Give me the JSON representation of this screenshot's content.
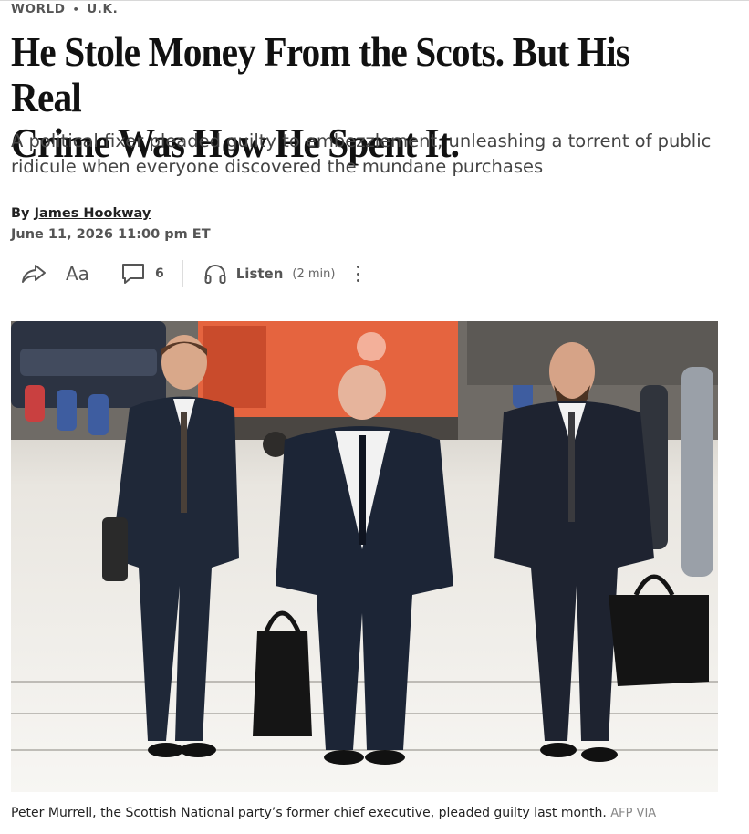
{
  "breadcrumb": {
    "section": "WORLD",
    "subsection": "U.K."
  },
  "article": {
    "headline_line1": "He Stole Money From the Scots. But His Real",
    "headline_line2": "Crime Was How He Spent It.",
    "dek_line1": "A political fixer pleaded guilty to embezzlement, unleashing a torrent of public",
    "dek_line2": "ridicule when everyone discovered the mundane purchases",
    "byline_prefix": "By",
    "author": "James Hookway",
    "date": "June 11, 2026 11:00 pm ET"
  },
  "toolbar": {
    "share_icon": "share-arrow-icon",
    "text_size_label": "Aa",
    "comment_icon": "comment-bubble-icon",
    "comment_count": "6",
    "listen_icon": "headphones-icon",
    "listen_label": "Listen",
    "listen_duration": "(2 min)",
    "more_icon": "vertical-ellipsis-icon"
  },
  "photo": {
    "caption": "Peter Murrell, the Scottish National party’s former chief executive, pleaded guilty last month.",
    "credit": "AFP VIA"
  },
  "colors": {
    "headline": "#111111",
    "dek": "#444444",
    "meta": "#555555"
  }
}
